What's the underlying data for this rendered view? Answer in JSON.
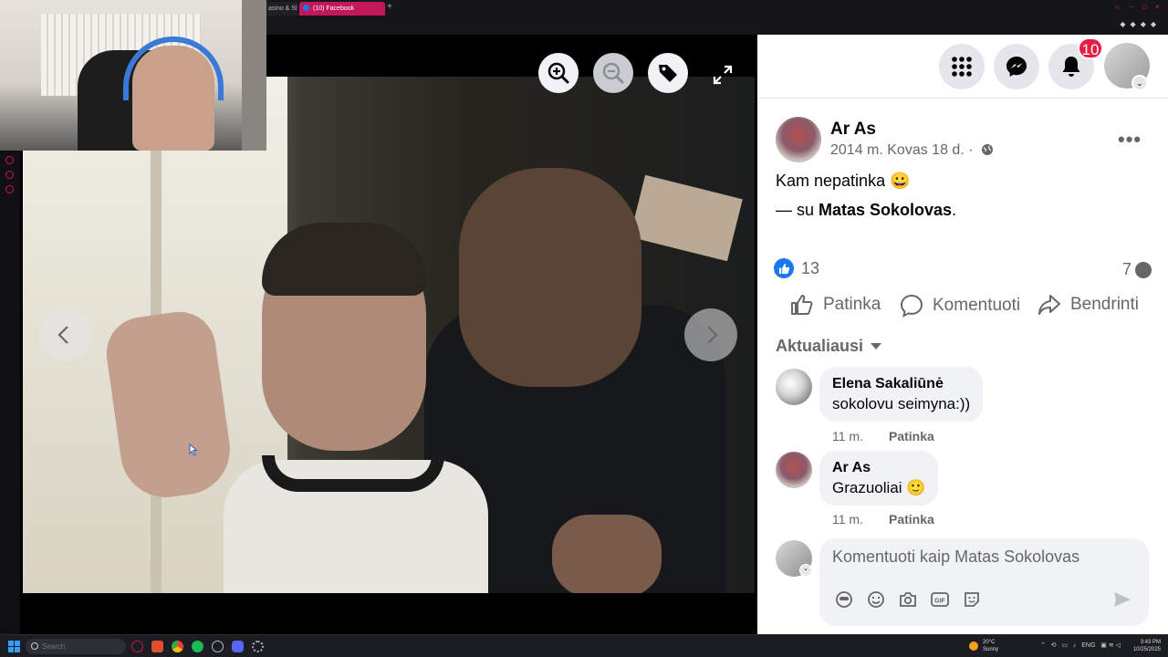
{
  "browser": {
    "tabs": [
      {
        "label": "asino & Sl"
      },
      {
        "label": "(10) Facebook"
      }
    ],
    "new_tab": "+"
  },
  "viewer": {
    "zoom_in_icon": "zoom-in-icon",
    "zoom_out_icon": "zoom-out-icon",
    "tag_icon": "tag-icon",
    "fullscreen_icon": "fullscreen-icon",
    "prev_icon": "chevron-left-icon",
    "next_icon": "chevron-right-icon"
  },
  "header": {
    "notification_count": "10"
  },
  "post": {
    "author": "Ar As",
    "date": "2014 m. Kovas 18 d. ·",
    "text": "Kam nepatinka 😀",
    "with_prefix": "— su ",
    "with_name": "Matas Sokolovas",
    "with_suffix": ".",
    "likes": "13",
    "comments": "7"
  },
  "actions": {
    "like": "Patinka",
    "comment": "Komentuoti",
    "share": "Bendrinti"
  },
  "sort": {
    "label": "Aktualiausi"
  },
  "comments": [
    {
      "author": "Elena Sakaliūnė",
      "text": "sokolovu seimyna:))",
      "time": "11 m.",
      "like": "Patinka"
    },
    {
      "author": "Ar As",
      "text": "Grazuoliai 🙂",
      "time": "11 m.",
      "like": "Patinka"
    }
  ],
  "composer": {
    "placeholder": "Komentuoti kaip Matas Sokolovas"
  },
  "taskbar": {
    "search_label": "Search",
    "weather_temp": "20°C",
    "weather_cond": "Sunny",
    "lang": "ENG",
    "time": "3:43 PM",
    "date": "10/25/2025"
  },
  "colors": {
    "facebook_blue": "#1877f2",
    "badge_red": "#e41e3f",
    "browser_accent": "#c2185b"
  }
}
